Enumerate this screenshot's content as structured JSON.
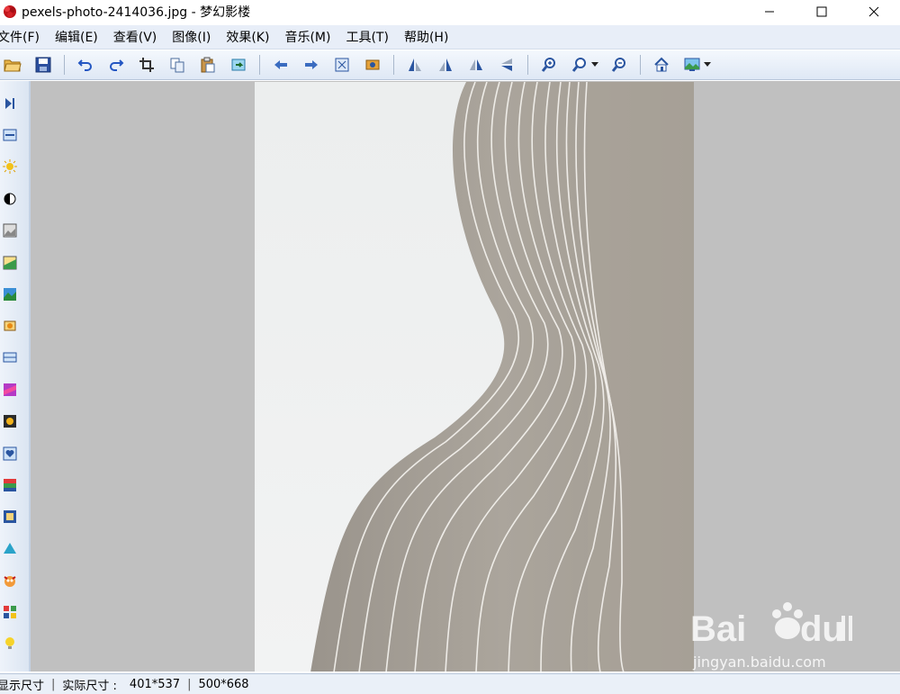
{
  "window": {
    "title": "pexels-photo-2414036.jpg - 梦幻影楼"
  },
  "menu": [
    {
      "label": "文件(F)"
    },
    {
      "label": "编辑(E)"
    },
    {
      "label": "查看(V)"
    },
    {
      "label": "图像(I)"
    },
    {
      "label": "效果(K)"
    },
    {
      "label": "音乐(M)"
    },
    {
      "label": "工具(T)"
    },
    {
      "label": "帮助(H)"
    }
  ],
  "toolbar": {
    "icons": [
      "open-folder-icon",
      "save-icon",
      "undo-icon",
      "redo-icon",
      "crop-icon",
      "copy-icon",
      "paste-icon",
      "export-icon",
      "previous-icon",
      "next-icon",
      "fit-window-icon",
      "fullscreen-icon",
      "rotate-left-icon",
      "rotate-right-icon",
      "flip-horizontal-icon",
      "flip-vertical-icon",
      "zoom-in-icon",
      "zoom-icon",
      "zoom-out-icon",
      "home-icon",
      "wallpaper-icon"
    ]
  },
  "status": {
    "display_size_label": "显示尺寸",
    "actual_size_label": "实际尺寸 :",
    "display_size_value": "401*537",
    "actual_size_value": "500*668"
  },
  "watermark": {
    "text": "jingyan.baidu.com"
  },
  "colors": {
    "menubar": "#e8eef8",
    "canvas": "#c0c0c0",
    "statusbar": "#eaf0f8"
  }
}
